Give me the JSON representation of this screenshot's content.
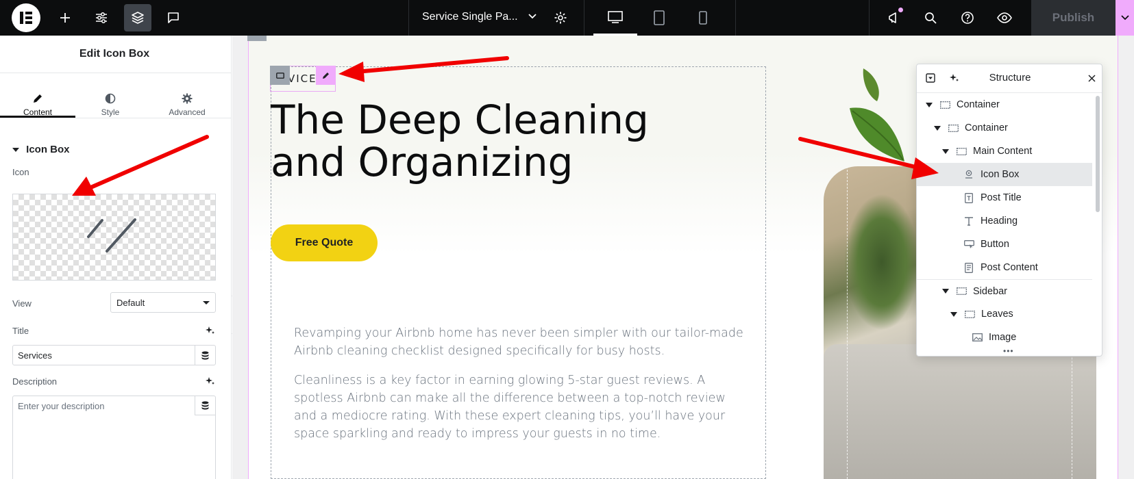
{
  "topbar": {
    "document_title": "Service Single Pa...",
    "publish_label": "Publish"
  },
  "panel": {
    "title": "Edit Icon Box",
    "tabs": [
      {
        "label": "Content",
        "icon": "pencil-icon"
      },
      {
        "label": "Style",
        "icon": "half-circle-icon"
      },
      {
        "label": "Advanced",
        "icon": "gear-icon"
      }
    ],
    "section_title": "Icon Box",
    "icon_label": "Icon",
    "view_label": "View",
    "view_value": "Default",
    "title_label": "Title",
    "title_value": "Services",
    "description_label": "Description",
    "description_placeholder": "Enter your description"
  },
  "canvas": {
    "services_text": "VICES",
    "heading": "The Deep Cleaning and Organizing",
    "button_label": "Free Quote",
    "paragraphs": [
      "Revamping your Airbnb home has never been simpler with our tailor-made Airbnb cleaning checklist designed specifically for busy hosts.",
      "Cleanliness is a key factor in earning glowing 5-star guest reviews. A spotless Airbnb can make all the difference between a top-notch review and a mediocre rating. With these expert cleaning tips, you’ll have your space sparkling and ready to impress your guests in no time."
    ]
  },
  "structure": {
    "title": "Structure",
    "items": [
      {
        "label": "Container"
      },
      {
        "label": "Container"
      },
      {
        "label": "Main Content"
      },
      {
        "label": "Icon Box"
      },
      {
        "label": "Post Title"
      },
      {
        "label": "Heading"
      },
      {
        "label": "Button"
      },
      {
        "label": "Post Content"
      },
      {
        "label": "Sidebar"
      },
      {
        "label": "Leaves"
      },
      {
        "label": "Image"
      }
    ]
  },
  "colors": {
    "accent_pink": "#f0abfc",
    "button_yellow": "#f2d213",
    "annotation_red": "#f00000"
  }
}
